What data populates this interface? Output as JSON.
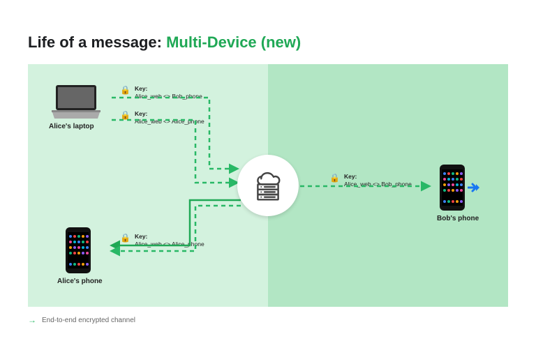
{
  "title": {
    "prefix": "Life of a message:",
    "accent": "Multi-Device (new)"
  },
  "devices": {
    "alice_laptop": "Alice's laptop",
    "alice_phone": "Alice's phone",
    "bob_phone": "Bob's phone"
  },
  "keys": {
    "bob_from_alice_web": {
      "title": "Key:",
      "pair": "Alice_web <> Bob_phone"
    },
    "alice_selfsync": {
      "title": "Key:",
      "pair": "Alice_web <> Alice_phone"
    },
    "alice_phone_in": {
      "title": "Key:",
      "pair": "Alice_web <> Alice_phone"
    },
    "bob_in": {
      "title": "Key:",
      "pair": "Alice_web <> Bob_phone"
    }
  },
  "legend": {
    "arrow": "→",
    "text": "End-to-end encrypted channel"
  },
  "colors": {
    "panel_left": "#d3f2de",
    "panel_right": "#b2e6c4",
    "accent": "#1fa855",
    "dashed": "#29b866",
    "solid": "#1fa855"
  }
}
